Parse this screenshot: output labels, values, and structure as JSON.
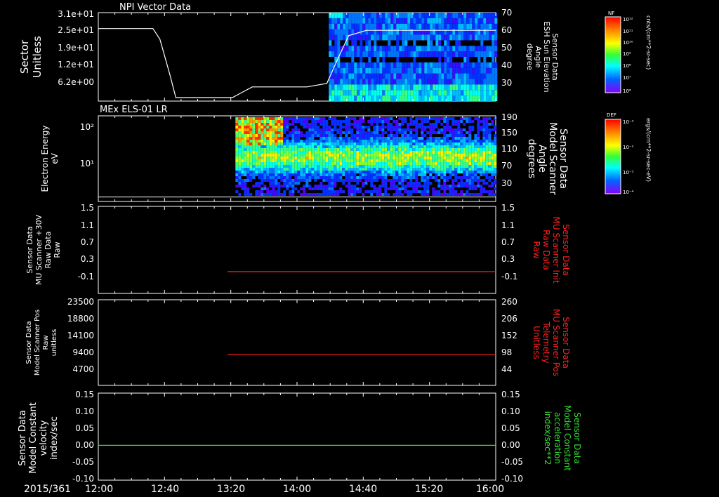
{
  "time_axis": {
    "date_label": "2015/361",
    "tick_labels": [
      "12:00",
      "12:40",
      "13:20",
      "14:00",
      "14:40",
      "15:20",
      "16:00"
    ],
    "range_hours": [
      12,
      16
    ]
  },
  "colors": {
    "background": "#000000",
    "foreground": "#ffffff",
    "red_trace": "#ff2020",
    "green_trace": "#33dd33"
  },
  "chart_data": [
    {
      "type": "heatmap",
      "title": "NPI Vector Data",
      "ylabel_lines": [
        "Sector",
        "Unitless"
      ],
      "y_tick_labels": [
        "3.1e+01",
        "2.5e+01",
        "1.9e+01",
        "1.2e+01",
        "6.2e+00"
      ],
      "right_label_lines": [
        "Sensor Data",
        "ESH Sun Elevation",
        "Angle",
        "degree"
      ],
      "right_tick_labels": [
        "70",
        "60",
        "50",
        "40",
        "30"
      ],
      "right_ylim": [
        20,
        70
      ],
      "colorbar": {
        "name": "NF",
        "unit": "cnts/(cm**2-sr-sec)",
        "tick_labels": [
          "10¹²",
          "10¹¹",
          "10¹⁰",
          "10⁹",
          "10⁸",
          "10⁷",
          "10⁶"
        ]
      },
      "overlay_line": {
        "x": [
          12.0,
          12.55,
          12.62,
          12.72,
          12.78,
          13.3,
          13.35,
          13.45,
          13.55,
          14.0,
          14.1,
          14.3,
          14.42,
          14.52,
          14.7,
          16.0
        ],
        "y": [
          61,
          61,
          55,
          35,
          22,
          22,
          22,
          25,
          28,
          28,
          28,
          30,
          45,
          57,
          60,
          60
        ]
      }
    },
    {
      "type": "heatmap",
      "title": "MEx ELS-01 LR",
      "ylabel_lines": [
        "Electron Energy",
        "eV"
      ],
      "y_tick_labels": [
        "10²",
        "10¹"
      ],
      "right_label_lines": [
        "Sensor Data",
        "Model Scanner",
        "Angle",
        "degrees"
      ],
      "right_tick_labels": [
        "190",
        "150",
        "110",
        "70",
        "30"
      ],
      "right_ylim": [
        0,
        190
      ],
      "colorbar": {
        "name": "DEF",
        "unit": "ergs/(cm**2-sr-sec-eV)",
        "tick_labels": [
          "10⁻⁴",
          "10⁻²",
          "10⁻³",
          "10⁻⁴"
        ]
      },
      "overlay_line": {
        "x": [
          12.0,
          16.0
        ],
        "y": [
          10,
          10
        ]
      }
    },
    {
      "type": "line",
      "ylabel_lines": [
        "Sensor Data",
        "MU Scanner +30V",
        "Raw Data",
        "Raw"
      ],
      "y_tick_labels": [
        "1.5",
        "1.1",
        "0.7",
        "0.3",
        "-0.1"
      ],
      "right_label_lines": [
        "Sensor Data",
        "MU Scanner Init",
        "Raw Data",
        "Raw"
      ],
      "right_tick_labels": [
        "1.5",
        "1.1",
        "0.7",
        "0.3",
        "-0.1"
      ],
      "ylim": [
        -0.5,
        1.5
      ],
      "series": [
        {
          "x": [
            13.3,
            16.0
          ],
          "y": [
            0.0,
            0.0
          ]
        }
      ]
    },
    {
      "type": "line",
      "ylabel_lines": [
        "Sensor Data",
        "Model Scanner Pos",
        "Raw",
        "unitless"
      ],
      "y_tick_labels": [
        "23500",
        "18800",
        "14100",
        "9400",
        "4700"
      ],
      "right_label_lines": [
        "Sensor Data",
        "MU Scanner Pos",
        "Telemetry",
        "Unitless"
      ],
      "right_tick_labels": [
        "260",
        "206",
        "152",
        "98",
        "44"
      ],
      "ylim": [
        0,
        23500
      ],
      "right_ylim": [
        -10,
        260
      ],
      "series": [
        {
          "x": [
            13.3,
            16.0
          ],
          "y": [
            88,
            88
          ]
        }
      ]
    },
    {
      "type": "line",
      "ylabel_lines": [
        "Sensor Data",
        "Model Constant",
        "velocity",
        "index/sec"
      ],
      "y_tick_labels": [
        "0.15",
        "0.10",
        "0.05",
        "0.00",
        "-0.05",
        "-0.10"
      ],
      "right_label_lines": [
        "Sensor Data",
        "Model Constant",
        "acceleration",
        "index/sec**2"
      ],
      "right_tick_labels": [
        "0.15",
        "0.10",
        "0.05",
        "0.00",
        "-0.05",
        "-0.10"
      ],
      "ylim": [
        -0.1,
        0.15
      ],
      "series": [
        {
          "x": [
            12.0,
            16.0
          ],
          "y": [
            0.0,
            0.0
          ]
        }
      ]
    }
  ]
}
